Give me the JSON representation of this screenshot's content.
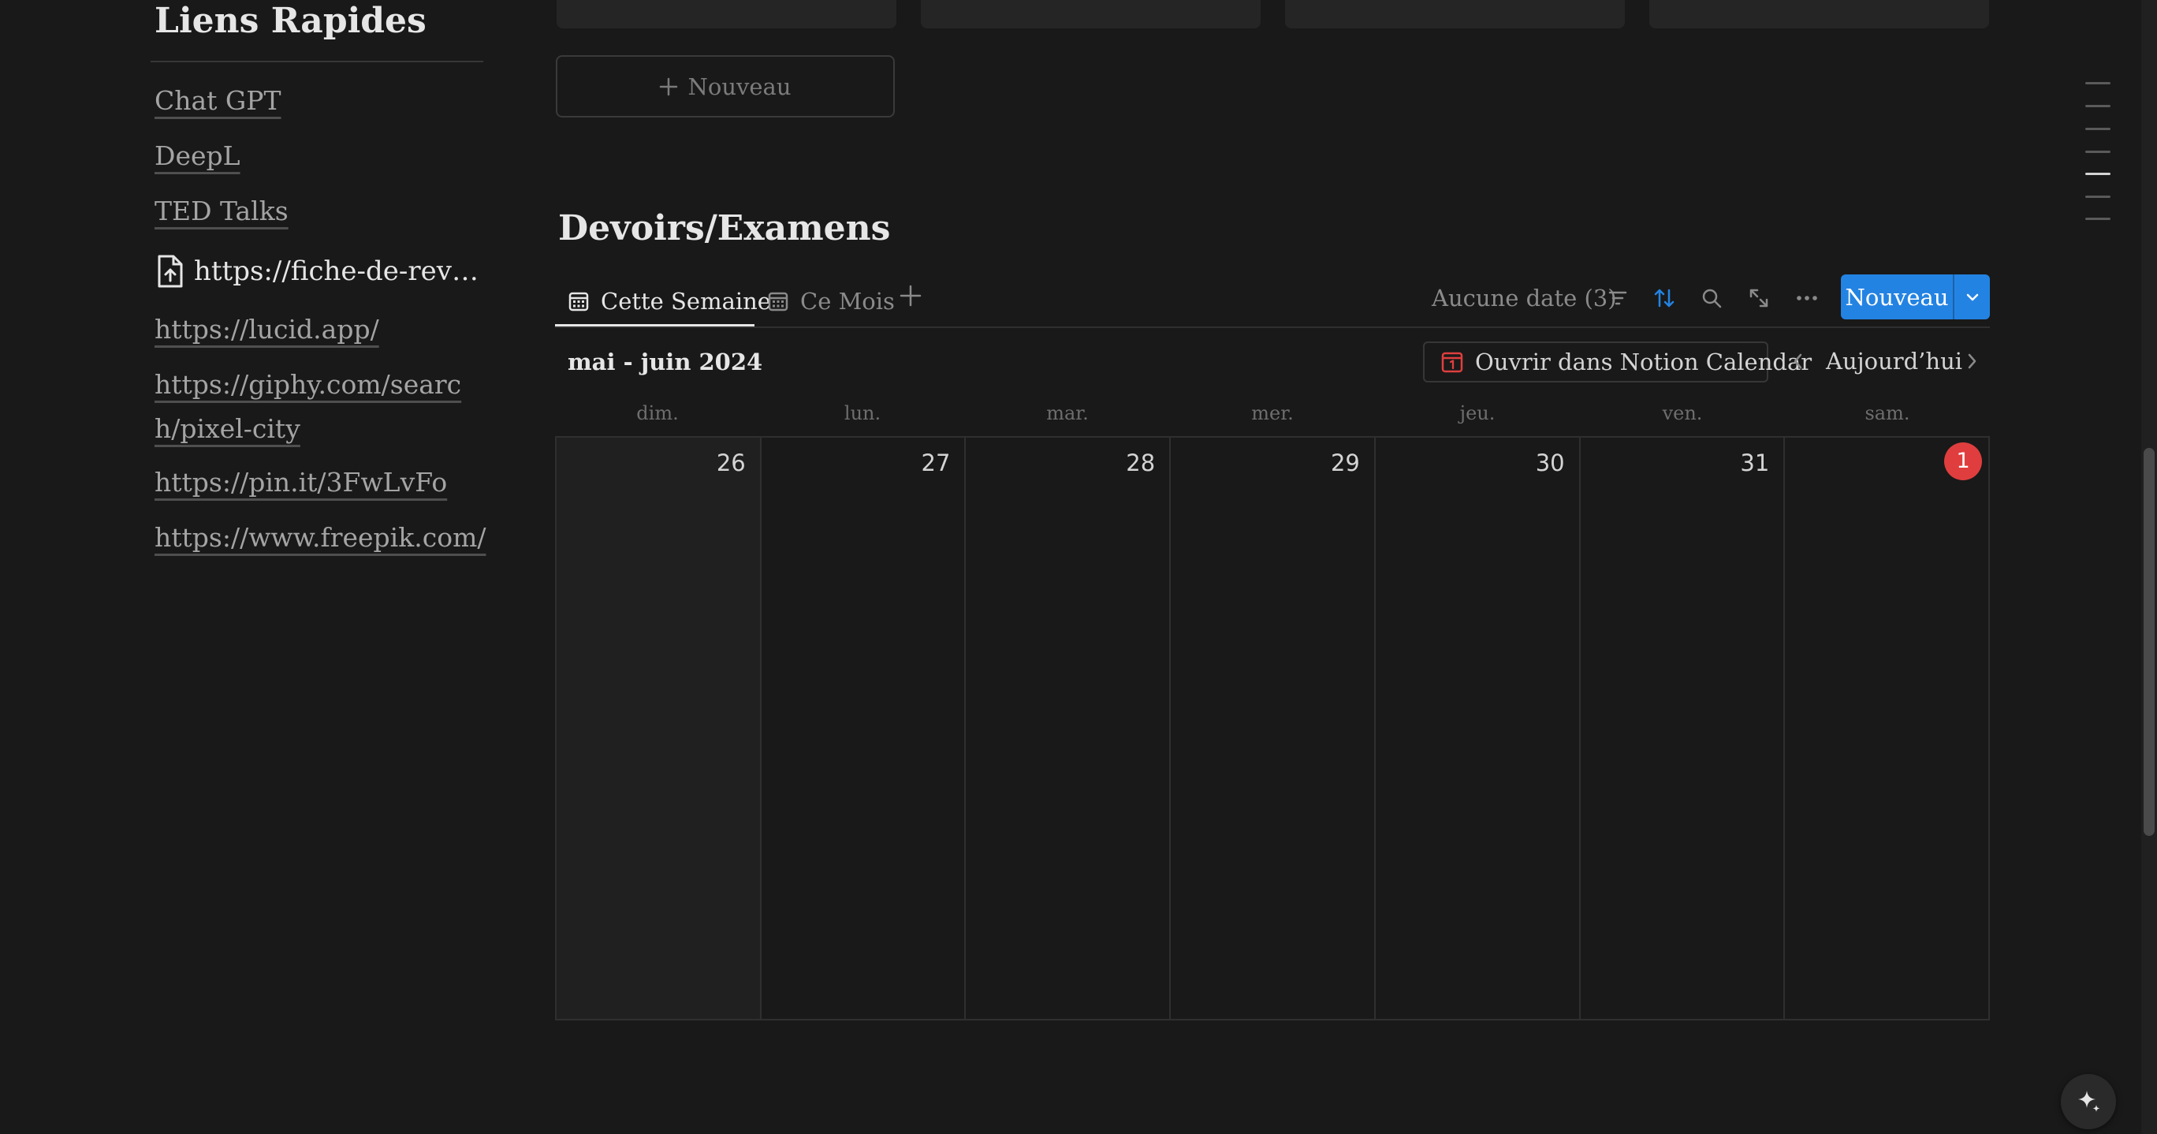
{
  "quick_links": {
    "title": "Liens Rapides",
    "items": [
      "Chat GPT",
      "DeepL",
      "TED Talks",
      "https://fiche-de-revisio...",
      "https://lucid.app/",
      "https://giphy.com/search/pixel-city",
      "https://pin.it/3FwLvFo",
      "https://www.freepik.com/"
    ]
  },
  "board": {
    "new_card_label": "Nouveau"
  },
  "database": {
    "title": "Devoirs/Examens",
    "tabs": [
      {
        "label": "Cette Semaine",
        "icon": "calendar-icon",
        "active": true
      },
      {
        "label": "Ce Mois",
        "icon": "calendar-icon",
        "active": false
      }
    ],
    "toolbar": {
      "no_date_label": "Aucune date (3)",
      "icons": [
        "filter-icon",
        "sort-icon",
        "search-icon",
        "expand-icon",
        "more-icon"
      ],
      "sort_color": "#2383e2",
      "new_label": "Nouveau"
    }
  },
  "calendar": {
    "range_label": "mai - juin 2024",
    "open_in_calendar_label": "Ouvrir dans Notion Calendar",
    "today_label": "Aujourd’hui",
    "weekdays": [
      "dim.",
      "lun.",
      "mar.",
      "mer.",
      "jeu.",
      "ven.",
      "sam."
    ],
    "days": [
      "26",
      "27",
      "28",
      "29",
      "30",
      "31",
      "1"
    ],
    "today_color": "#e03e3e",
    "accent_color": "#2383e2"
  }
}
